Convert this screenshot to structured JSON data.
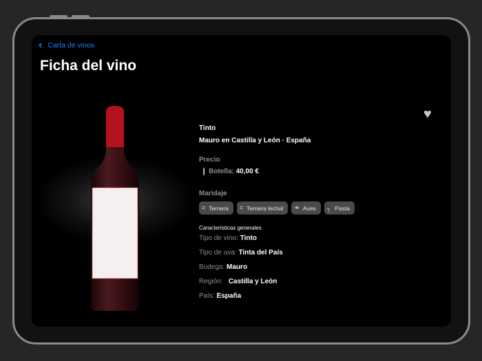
{
  "nav": {
    "back_label": "Carta de vinos"
  },
  "page": {
    "title": "Ficha del vino"
  },
  "wine": {
    "type": "Tinto",
    "origin": "Mauro en Castilla y León · España",
    "price_heading": "Precio",
    "price_label": "Botella:",
    "price_value": "40,00 €",
    "pairing_heading": "Maridaje",
    "pairings": [
      {
        "label": "Ternera",
        "icon": "cow-icon"
      },
      {
        "label": "Ternera lechal",
        "icon": "calf-icon"
      },
      {
        "label": "Aves",
        "icon": "bird-icon"
      },
      {
        "label": "Pasta",
        "icon": "pasta-icon"
      }
    ],
    "characteristics_heading": "Características generales",
    "characteristics": [
      {
        "label": "Tipo de vino:",
        "value": "Tinto"
      },
      {
        "label": "Tipo de uva:",
        "value": "Tinta del País"
      },
      {
        "label": "Bodega:",
        "value": "Mauro"
      },
      {
        "label": "Región:",
        "value": "Castilla y León"
      },
      {
        "label": "País:",
        "value": "España"
      }
    ]
  },
  "colors": {
    "accent": "#1a82ff",
    "bottle_cap": "#b3121e"
  }
}
